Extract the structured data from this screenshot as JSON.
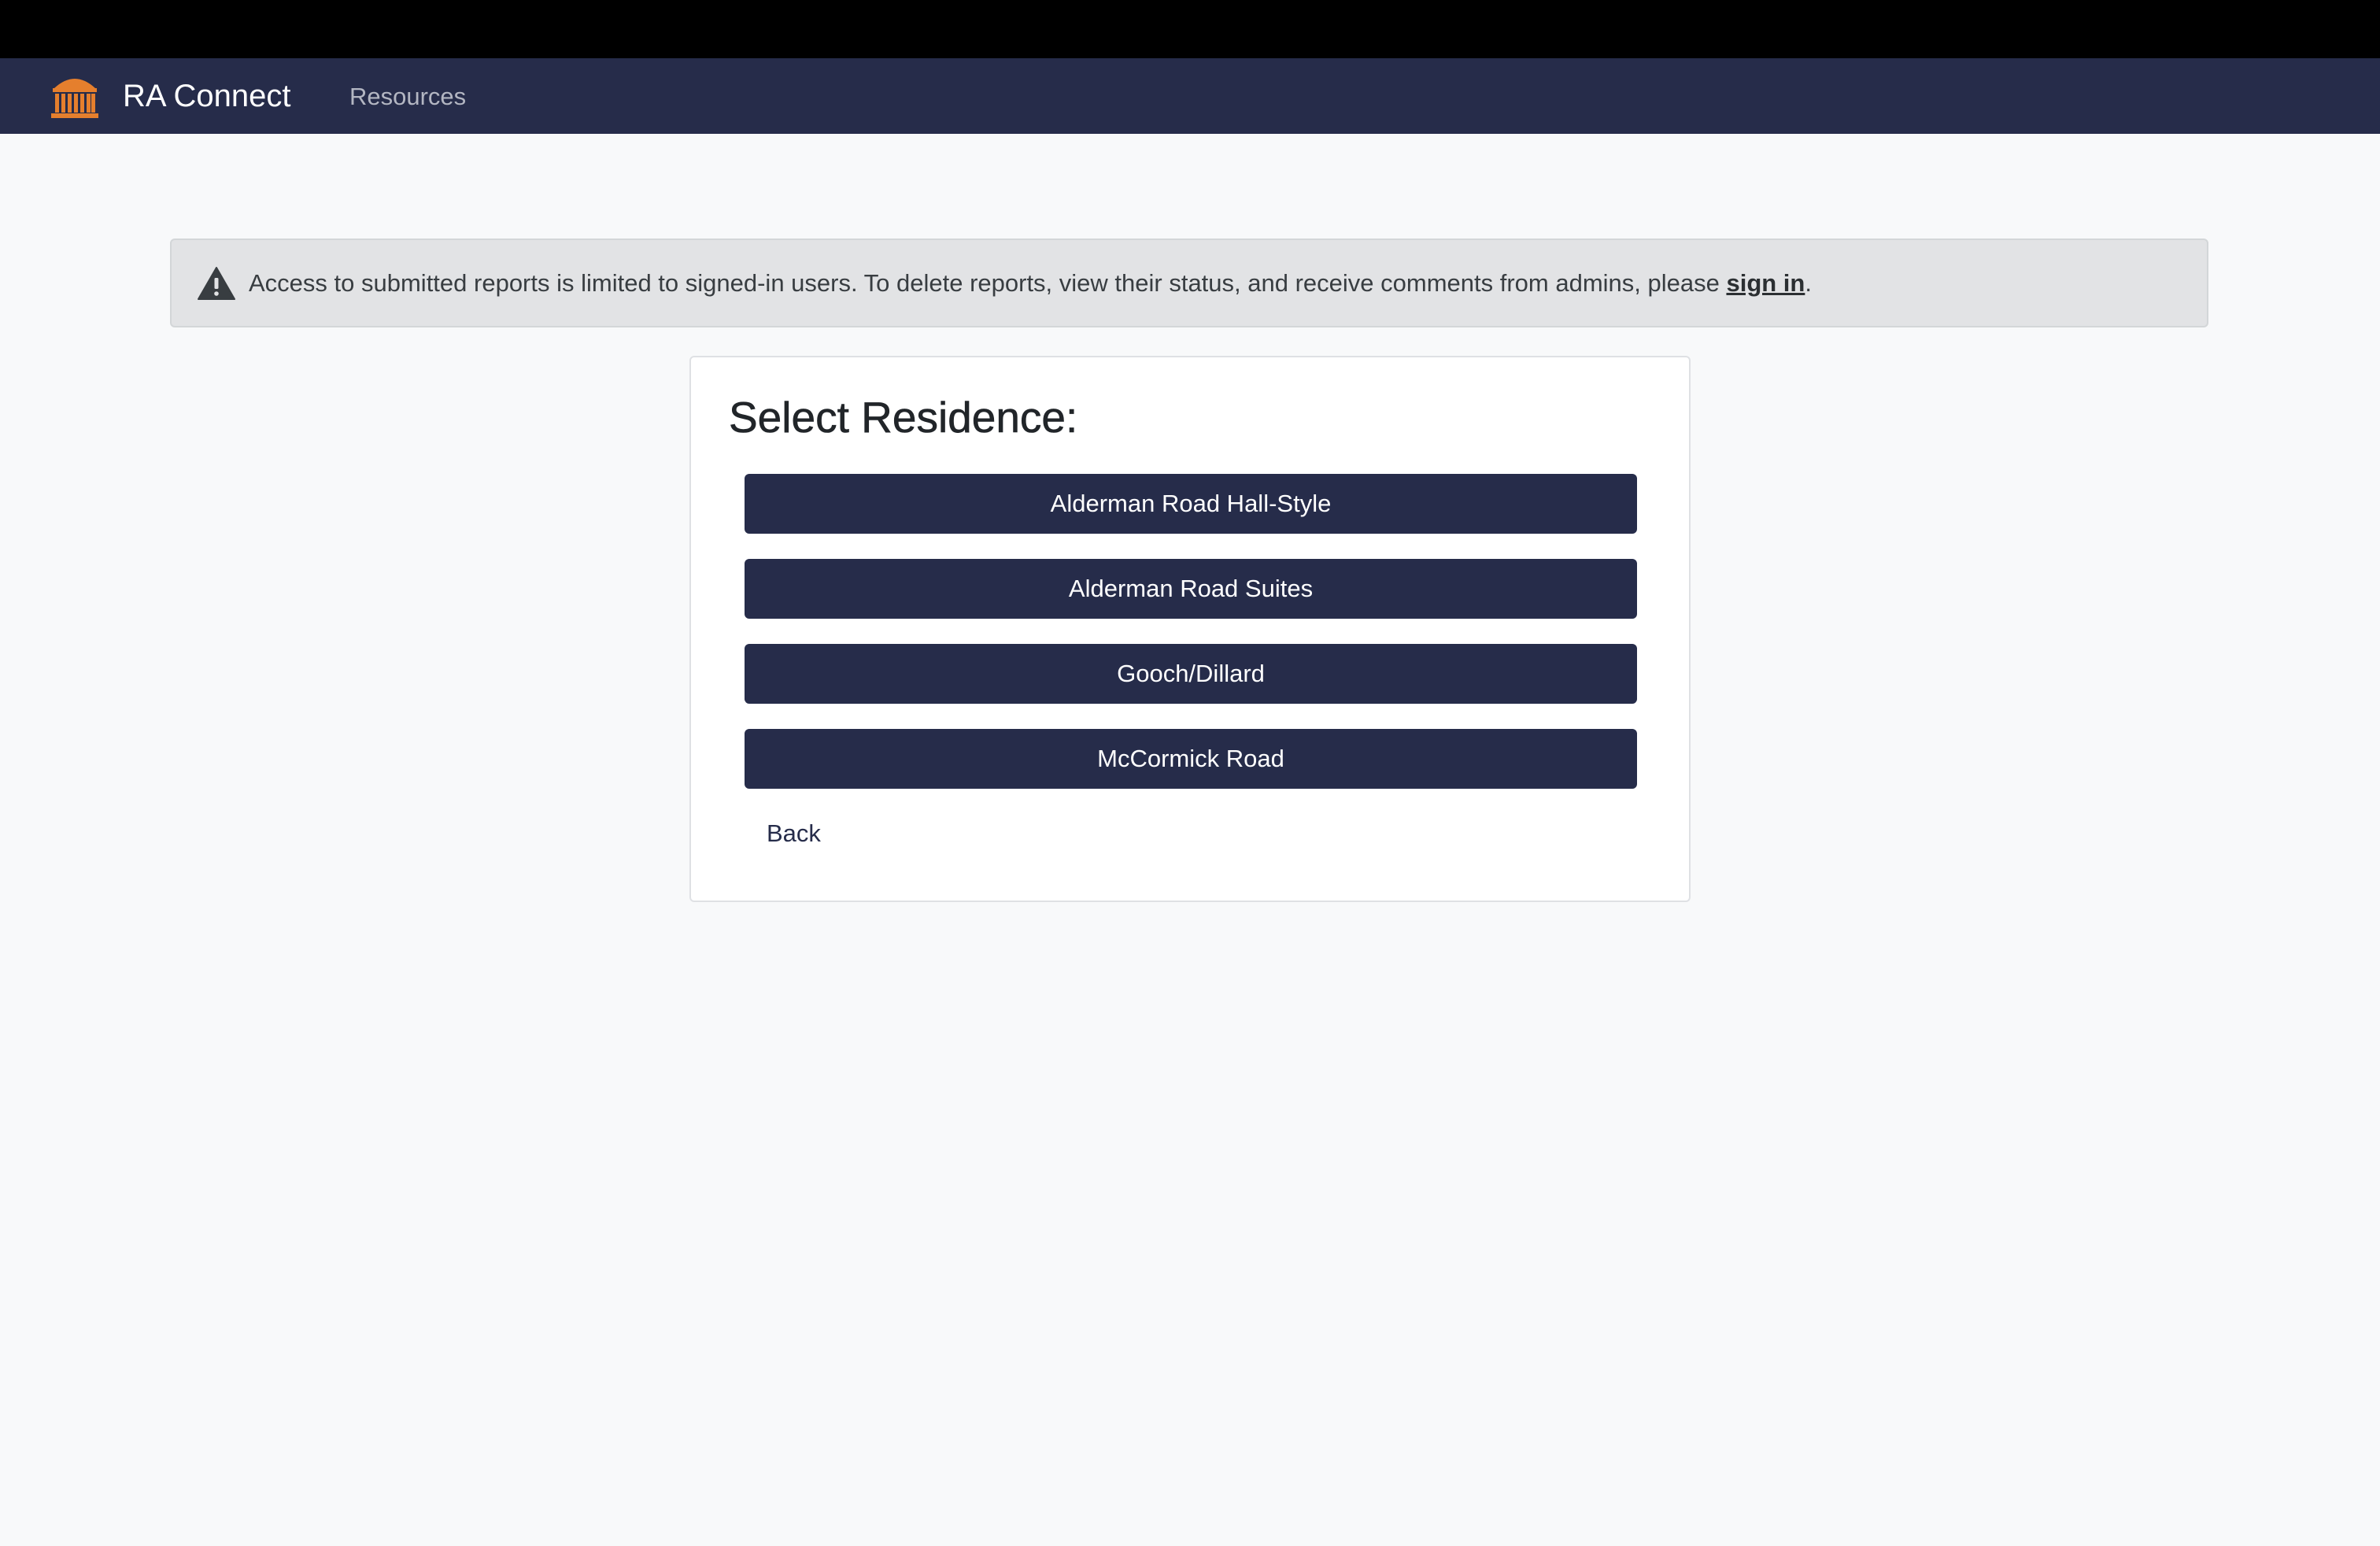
{
  "app": {
    "title": "RA Connect",
    "logo_icon": "rotunda-icon",
    "logo_color": "#e57f2d",
    "nav_color": "#262c4a"
  },
  "nav": {
    "links": [
      {
        "label": "Resources"
      }
    ]
  },
  "alert": {
    "icon": "warning-triangle-icon",
    "text_before": "Access to submitted reports is limited to signed-in users. To delete reports, view their status, and receive comments from admins, please ",
    "link_label": "sign in",
    "text_after": "."
  },
  "residence_select": {
    "title": "Select Residence:",
    "options": [
      {
        "label": "Alderman Road Hall-Style"
      },
      {
        "label": "Alderman Road Suites"
      },
      {
        "label": "Gooch/Dillard"
      },
      {
        "label": "McCormick Road"
      }
    ],
    "back_label": "Back",
    "button_color": "#262c4a"
  }
}
